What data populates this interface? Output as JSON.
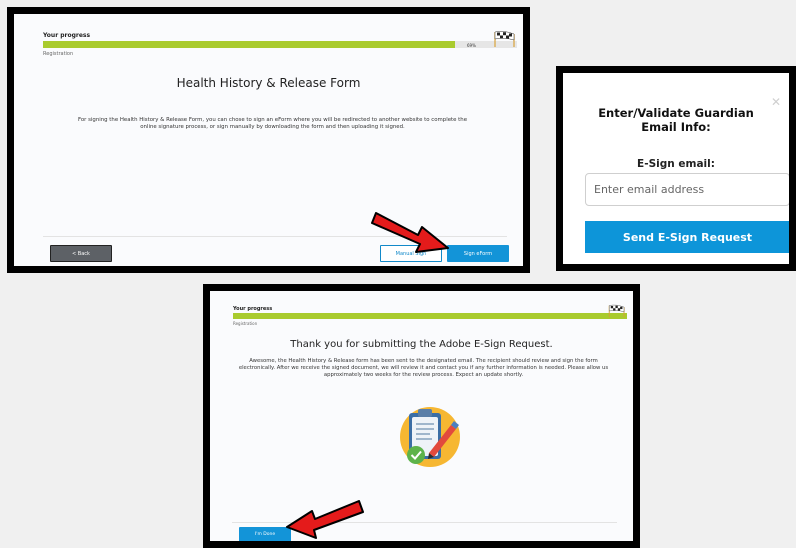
{
  "panel1": {
    "progress": {
      "label": "Your progress",
      "percent_text": "69%",
      "fill": 0.87,
      "step": "Registration"
    },
    "title": "Health History & Release Form",
    "description": "For signing the Health History & Release Form, you can chose to sign an eForm where you will be redirected to another website to complete the online signature process, or sign manually by downloading the form and then uploading it signed.",
    "back_label": "< Back",
    "manual_label": "Manual Sign",
    "esign_label": "Sign eForm"
  },
  "panel2": {
    "title": "Enter/Validate Guardian Email Info:",
    "close_icon": "close-icon",
    "field_label": "E-Sign email:",
    "email_placeholder": "Enter email address",
    "send_label": "Send E-Sign Request"
  },
  "panel3": {
    "progress": {
      "label": "Your progress",
      "fill": 1.0,
      "step": "Registration"
    },
    "title": "Thank you for submitting the Adobe E-Sign Request.",
    "message": "Awesome, the Health History & Release form has been sent to the designated email. The recipient should review and sign the form electronically. After we receive the signed document, we will review it and contact you if any further information is needed. Please allow us approximately two weeks for the review process. Expect an update shortly.",
    "done_label": "I'm Done"
  },
  "colors": {
    "progress": "#a9cb2e",
    "primary": "#1394d8",
    "arrow": "#e41b1b",
    "back_button": "#5d6166"
  },
  "icons": [
    "checkered-flag-icon",
    "clipboard-checkmark-icon",
    "close-icon",
    "red-arrow-pointer"
  ]
}
